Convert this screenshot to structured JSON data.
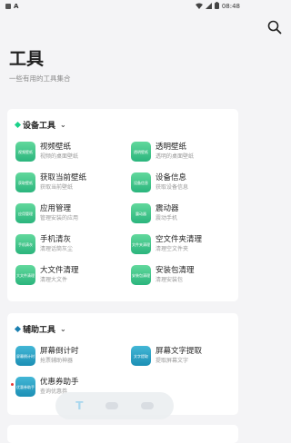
{
  "status": {
    "time": "08:48"
  },
  "header": {
    "title": "工具",
    "subtitle": "一些有用的工具集合"
  },
  "sections": [
    {
      "title": "设备工具",
      "accent": "#1bd18a",
      "items": [
        {
          "name": "视频壁纸",
          "desc": "视频的桌面壁纸",
          "icon_text": "视频壁纸",
          "color": "green"
        },
        {
          "name": "透明壁纸",
          "desc": "透明的桌面壁纸",
          "icon_text": "透明壁纸",
          "color": "green"
        },
        {
          "name": "获取当前壁纸",
          "desc": "获取当前壁纸",
          "icon_text": "获取壁纸",
          "color": "green"
        },
        {
          "name": "设备信息",
          "desc": "获取设备信息",
          "icon_text": "设备信息",
          "color": "green"
        },
        {
          "name": "应用管理",
          "desc": "管理安装的应用",
          "icon_text": "应用管理",
          "color": "green"
        },
        {
          "name": "震动器",
          "desc": "震动手机",
          "icon_text": "震动器",
          "color": "green"
        },
        {
          "name": "手机清灰",
          "desc": "清理话筒灰尘",
          "icon_text": "手机清灰",
          "color": "green"
        },
        {
          "name": "空文件夹清理",
          "desc": "清理空文件夹",
          "icon_text": "文件夹清理",
          "color": "green"
        },
        {
          "name": "大文件清理",
          "desc": "清理大文件",
          "icon_text": "大文件清理",
          "color": "green"
        },
        {
          "name": "安装包清理",
          "desc": "清理安装包",
          "icon_text": "安装包清理",
          "color": "green"
        }
      ]
    },
    {
      "title": "辅助工具",
      "accent": "#1a7fb0",
      "items": [
        {
          "name": "屏幕倒计时",
          "desc": "抢票辅助神器",
          "icon_text": "屏幕倒计时",
          "color": "blue"
        },
        {
          "name": "屏幕文字提取",
          "desc": "提取屏幕文字",
          "icon_text": "文字提取",
          "color": "blue"
        },
        {
          "name": "优惠券助手",
          "desc": "查询优惠券",
          "icon_text": "优惠券助手",
          "color": "blue"
        }
      ]
    }
  ],
  "bottom_nav": {
    "active_tab": "T"
  }
}
